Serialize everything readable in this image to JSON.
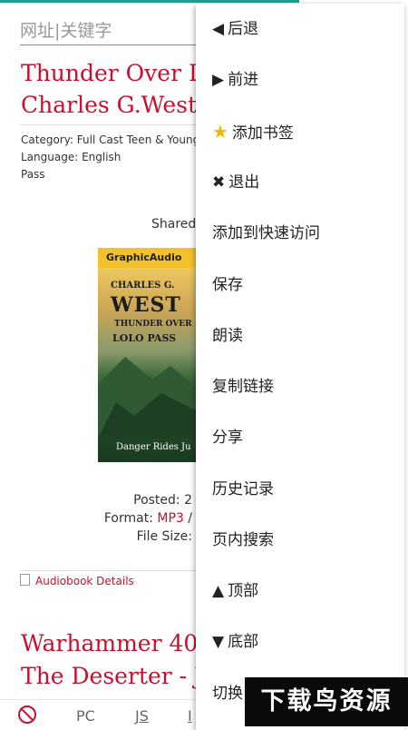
{
  "url_placeholder": "网址|关键字",
  "post1": {
    "title_line1": "Thunder Over L",
    "title_line2": "Charles G.West",
    "meta_line1": "Category: Full Cast  Teen & Young",
    "meta_line2": "Language: English",
    "meta_line3": "Pass",
    "shared": "Shared",
    "cover": {
      "brand": "GraphicAudio",
      "author": "CHARLES G.",
      "surname": "WEST",
      "subtitle1": "THUNDER OVER",
      "subtitle2": "LOLO PASS",
      "tagline": "Danger Rides Ju"
    },
    "posted": "Posted: 2",
    "format_label": "Format:",
    "format_value": "MP3",
    "format_tail": " /",
    "filesize": "File Size:",
    "details_link": "Audiobook Details"
  },
  "post2": {
    "title_line1": "Warhammer 40",
    "title_line2": "The Deserter - Ju"
  },
  "menu": {
    "back": "后退",
    "forward": "前进",
    "bookmark": "添加书签",
    "exit": "退出",
    "quick_access": "添加到快速访问",
    "save": "保存",
    "read_aloud": "朗读",
    "copy_link": "复制链接",
    "share": "分享",
    "history": "历史记录",
    "find_in_page": "页内搜索",
    "top": "顶部",
    "bottom": "底部",
    "switch": "切换"
  },
  "bottombar": {
    "pc": "PC",
    "js": "JS",
    "img": "I"
  },
  "watermark": "下载鸟资源",
  "colors": {
    "accent": "#c8102e",
    "progress": "#1e9e8e",
    "star": "#f4b400"
  }
}
